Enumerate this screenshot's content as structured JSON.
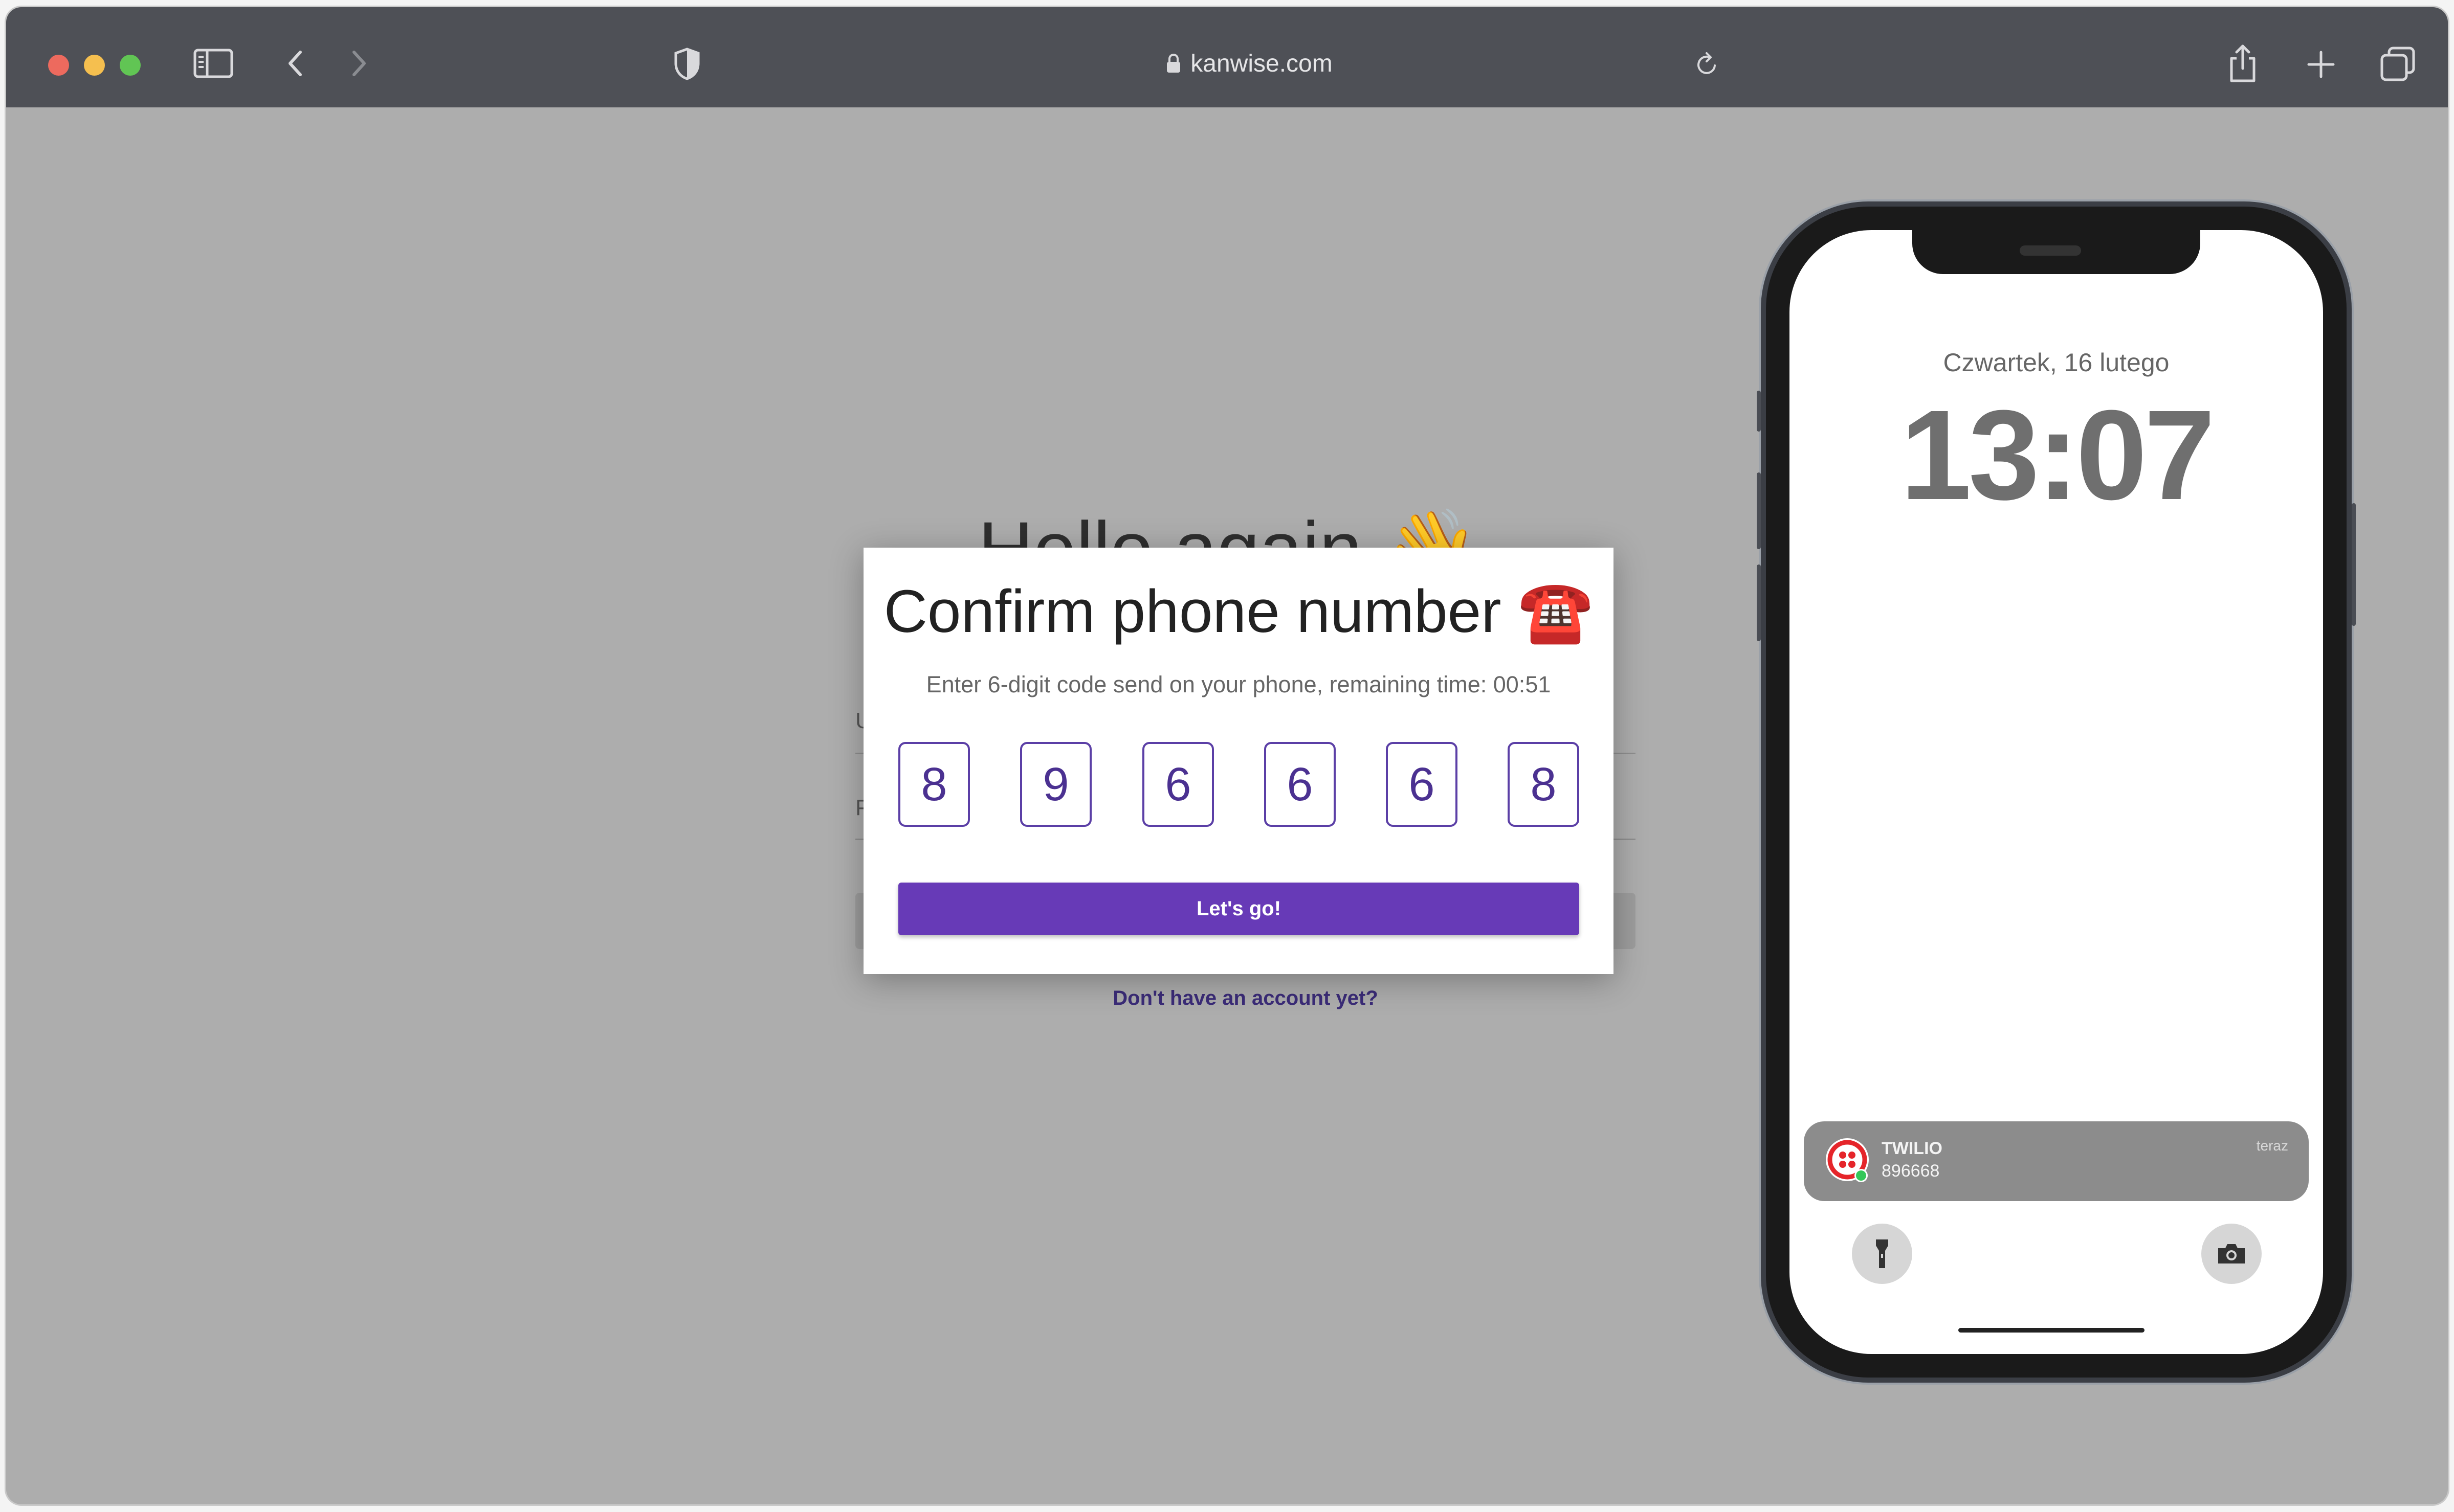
{
  "browser": {
    "url": "kanwise.com",
    "icons": {
      "sidebar": "sidebar-icon",
      "back": "chevron-left-icon",
      "forward": "chevron-right-icon",
      "shield": "shield-icon",
      "lock": "lock-icon",
      "reload": "reload-icon",
      "share": "share-icon",
      "new_tab": "plus-icon",
      "tabs": "tabs-overview-icon"
    }
  },
  "background_page": {
    "heading": "Hello again 👋",
    "username_initial": "U",
    "password_initial": "P",
    "signup_link": "Don't have an account yet?"
  },
  "modal": {
    "title": "Confirm phone number ☎️",
    "subtitle": "Enter 6-digit code send on your phone, remaining time: 00:51",
    "digits": [
      "8",
      "9",
      "6",
      "6",
      "6",
      "8"
    ],
    "submit_label": "Let's go!"
  },
  "phone": {
    "date": "Czwartek, 16 lutego",
    "time": "13:07",
    "notification": {
      "app": "TWILIO",
      "message": "896668",
      "time": "teraz"
    },
    "icons": {
      "flashlight": "flashlight-icon",
      "camera": "camera-icon"
    }
  },
  "colors": {
    "accent": "#673ab7",
    "digit_border": "#5b3fa6",
    "overlay": "#adadad",
    "titlebar": "#4e5056",
    "twilio_red": "#e5252a"
  }
}
